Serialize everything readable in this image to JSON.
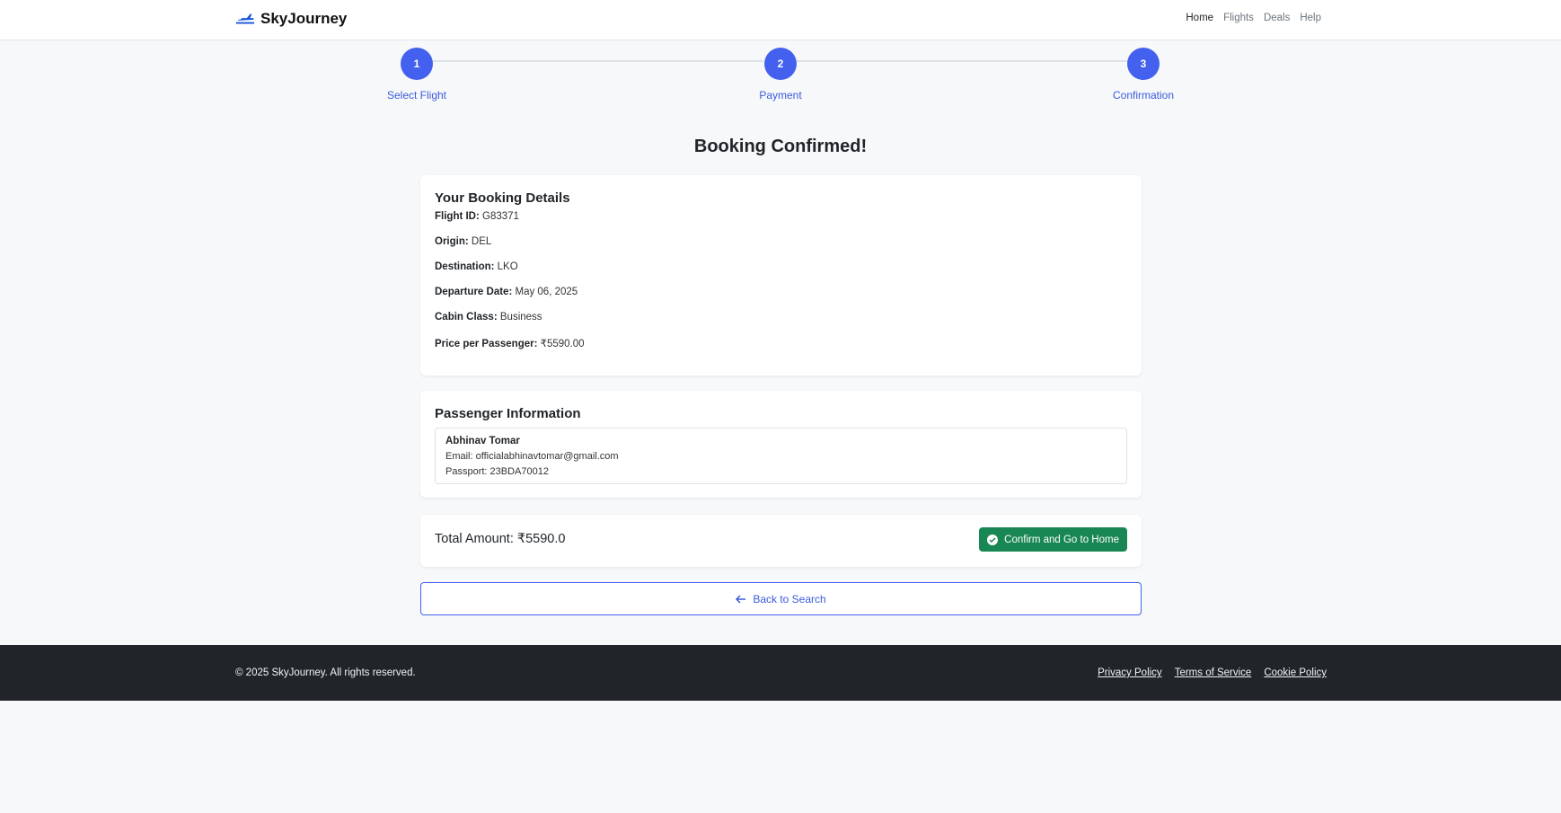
{
  "brand": {
    "name": "SkyJourney",
    "logo_icon": "airplane-icon"
  },
  "nav": {
    "links": [
      "Home",
      "Flights",
      "Deals",
      "Help"
    ],
    "active": "Home"
  },
  "stepper": {
    "steps": [
      {
        "number": "1",
        "label": "Select Flight"
      },
      {
        "number": "2",
        "label": "Payment"
      },
      {
        "number": "3",
        "label": "Confirmation"
      }
    ],
    "current": 3
  },
  "page_title": "Booking Confirmed!",
  "booking_details": {
    "title": "Your Booking Details",
    "fields": [
      {
        "label": "Flight ID:",
        "value": "G83371"
      },
      {
        "label": "Origin:",
        "value": "DEL"
      },
      {
        "label": "Destination:",
        "value": "LKO"
      },
      {
        "label": "Departure Date:",
        "value": "May 06, 2025"
      },
      {
        "label": "Cabin Class:",
        "value": "Business"
      },
      {
        "label": "Price per Passenger:",
        "value": "₹5590.00"
      }
    ]
  },
  "passenger_info": {
    "title": "Passenger Information",
    "passengers": [
      {
        "name": "Abhinav Tomar",
        "email": "Email: officialabhinavtomar@gmail.com",
        "passport": "Passport: 23BDA70012"
      }
    ]
  },
  "summary": {
    "total": "Total Amount: ₹5590.0",
    "confirm_label": "Confirm and Go to Home",
    "confirm_icon": "check-circle-icon"
  },
  "back_button": {
    "label": "Back to Search",
    "icon": "arrow-left-icon"
  },
  "footer": {
    "copyright": "© 2025 SkyJourney. All rights reserved.",
    "links": [
      "Privacy Policy",
      "Terms of Service",
      "Cookie Policy"
    ]
  },
  "colors": {
    "primary": "#4361ee",
    "success": "#198754",
    "footer_bg": "#212529",
    "page_bg": "#f7f8fa"
  }
}
